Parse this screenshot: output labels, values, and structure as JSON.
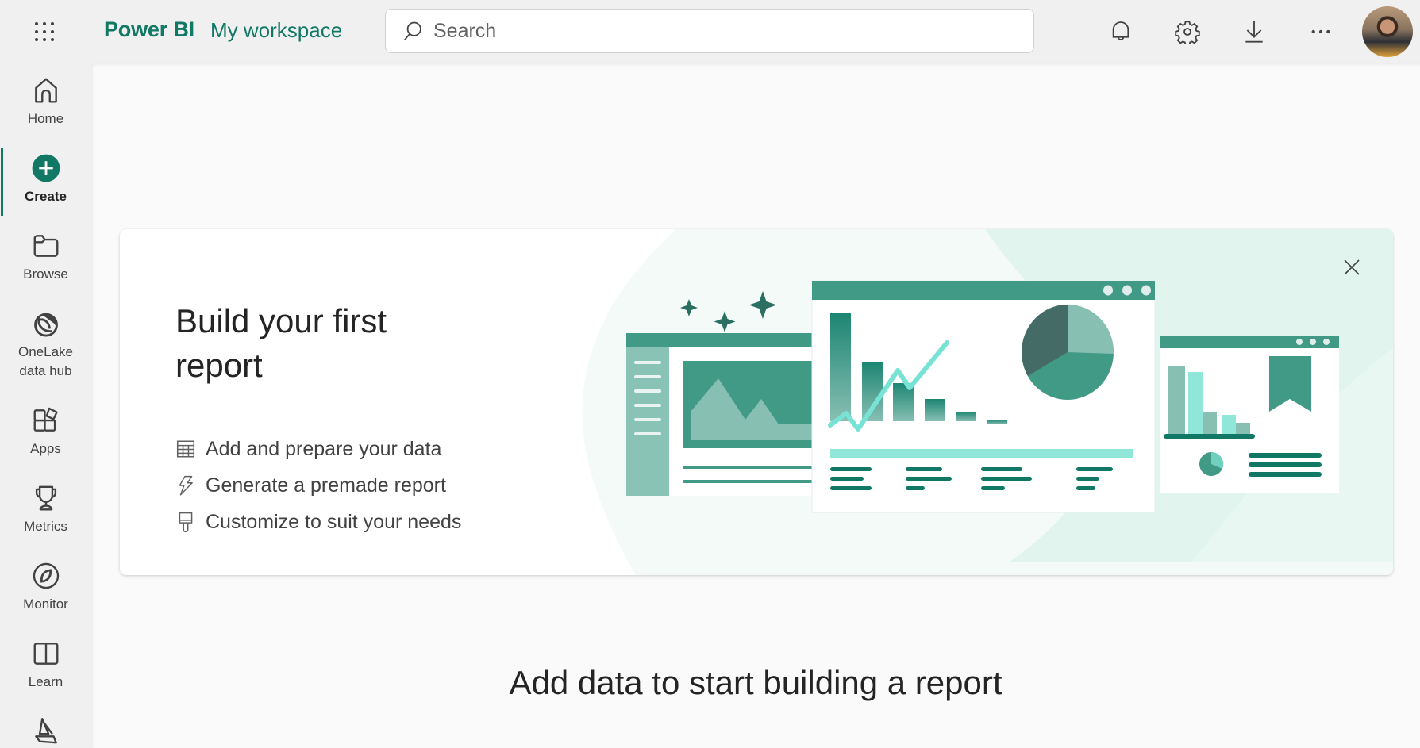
{
  "topbar": {
    "brand": "Power BI",
    "workspace": "My workspace",
    "search_placeholder": "Search",
    "icons": [
      "app-launcher-icon",
      "search-icon",
      "bell-icon",
      "gear-icon",
      "download-icon",
      "more-icon",
      "avatar"
    ]
  },
  "sidebar": {
    "items": [
      {
        "label": "Home",
        "icon": "home-icon",
        "active": false
      },
      {
        "label": "Create",
        "icon": "create-plus-icon",
        "active": true
      },
      {
        "label": "Browse",
        "icon": "folder-icon",
        "active": false
      },
      {
        "label": "OneLake\ndata hub",
        "icon": "onelake-icon",
        "active": false
      },
      {
        "label": "Apps",
        "icon": "apps-icon",
        "active": false
      },
      {
        "label": "Metrics",
        "icon": "trophy-icon",
        "active": false
      },
      {
        "label": "Monitor",
        "icon": "monitor-compass-icon",
        "active": false
      },
      {
        "label": "Learn",
        "icon": "book-icon",
        "active": false
      },
      {
        "label": "",
        "icon": "workloads-icon",
        "active": false
      }
    ]
  },
  "card": {
    "title": "Build your first report",
    "bullets": [
      {
        "icon": "table-icon",
        "text": "Add and prepare your data"
      },
      {
        "icon": "lightning-icon",
        "text": "Generate a premade report"
      },
      {
        "icon": "paintbrush-icon",
        "text": "Customize to suit your needs"
      }
    ],
    "close_icon": "close-icon"
  },
  "main": {
    "heading": "Add data to start building a report"
  },
  "colors": {
    "brand": "#117865",
    "accent_teal": "#419a86",
    "light_teal": "#8fe6d9",
    "illustration_bg": "#e1f4ee"
  }
}
